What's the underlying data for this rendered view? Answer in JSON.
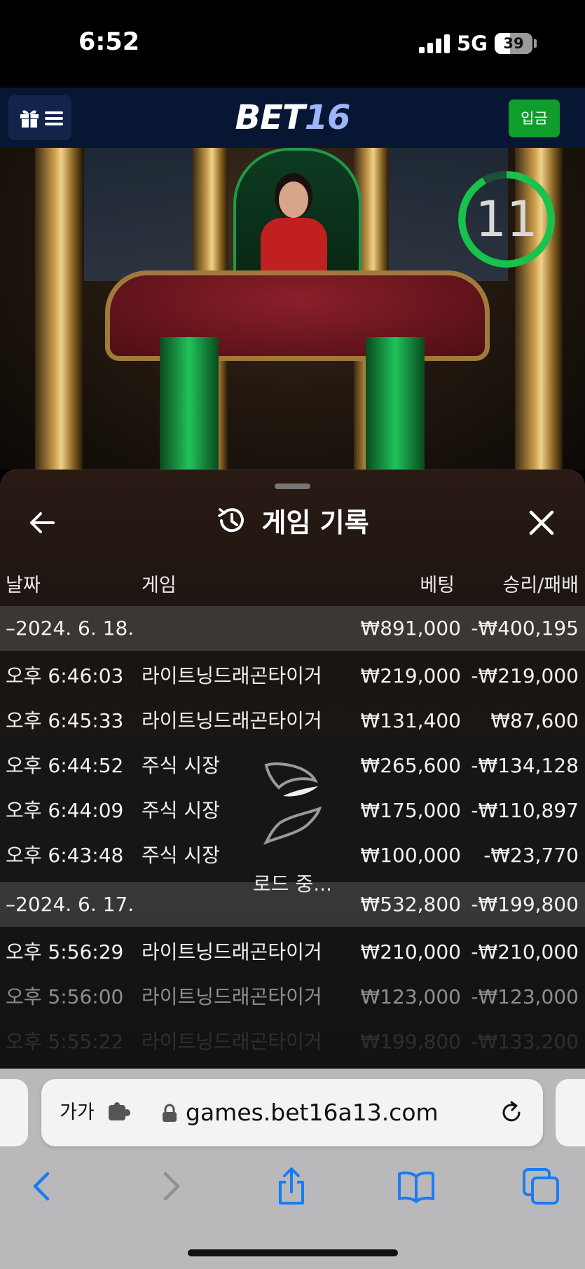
{
  "status_bar": {
    "time": "6:52",
    "network": "5G",
    "battery": "39"
  },
  "header": {
    "logo_main": "BET",
    "logo_num": "16",
    "deposit_label": "입금"
  },
  "video": {
    "countdown": "11"
  },
  "history": {
    "title": "게임 기록",
    "columns": {
      "date": "날짜",
      "game": "게임",
      "bet": "베팅",
      "result": "승리/패배"
    },
    "rows": [
      {
        "type": "group",
        "label": "–2024. 6. 18.",
        "bet": "₩891,000",
        "result": "-₩400,195"
      },
      {
        "type": "item",
        "time": "오후 6:46:03",
        "game": "라이트닝드래곤타이거",
        "bet": "₩219,000",
        "result": "-₩219,000"
      },
      {
        "type": "item",
        "time": "오후 6:45:33",
        "game": "라이트닝드래곤타이거",
        "bet": "₩131,400",
        "result": "₩87,600"
      },
      {
        "type": "item",
        "time": "오후 6:44:52",
        "game": "주식 시장",
        "bet": "₩265,600",
        "result": "-₩134,128"
      },
      {
        "type": "item",
        "time": "오후 6:44:09",
        "game": "주식 시장",
        "bet": "₩175,000",
        "result": "-₩110,897"
      },
      {
        "type": "item",
        "time": "오후 6:43:48",
        "game": "주식 시장",
        "bet": "₩100,000",
        "result": "-₩23,770"
      },
      {
        "type": "group",
        "label": "–2024. 6. 17.",
        "bet": "₩532,800",
        "result": "-₩199,800"
      },
      {
        "type": "item",
        "time": "오후 5:56:29",
        "game": "라이트닝드래곤타이거",
        "bet": "₩210,000",
        "result": "-₩210,000"
      },
      {
        "type": "item",
        "time": "오후 5:56:00",
        "game": "라이트닝드래곤타이거",
        "bet": "₩123,000",
        "result": "-₩123,000"
      },
      {
        "type": "item",
        "time": "오후 5:55:22",
        "game": "라이트닝드래곤타이거",
        "bet": "₩199,800",
        "result": "-₩133,200"
      }
    ],
    "loading_text": "로드 중..."
  },
  "browser": {
    "text_size_label": "가가",
    "url": "games.bet16a13.com"
  },
  "icons": [
    "gift-icon",
    "menu-icon",
    "back-arrow-icon",
    "history-clock-icon",
    "close-icon",
    "loading-spinner-icon",
    "extension-icon",
    "lock-icon",
    "reload-icon",
    "back-icon",
    "forward-icon",
    "share-icon",
    "bookmarks-icon",
    "tabs-icon"
  ],
  "colors": {
    "header_bg": "#071633",
    "deposit_green": "#0f9d2b",
    "timer_green": "#19c24a",
    "link_blue": "#1a7cf5"
  }
}
